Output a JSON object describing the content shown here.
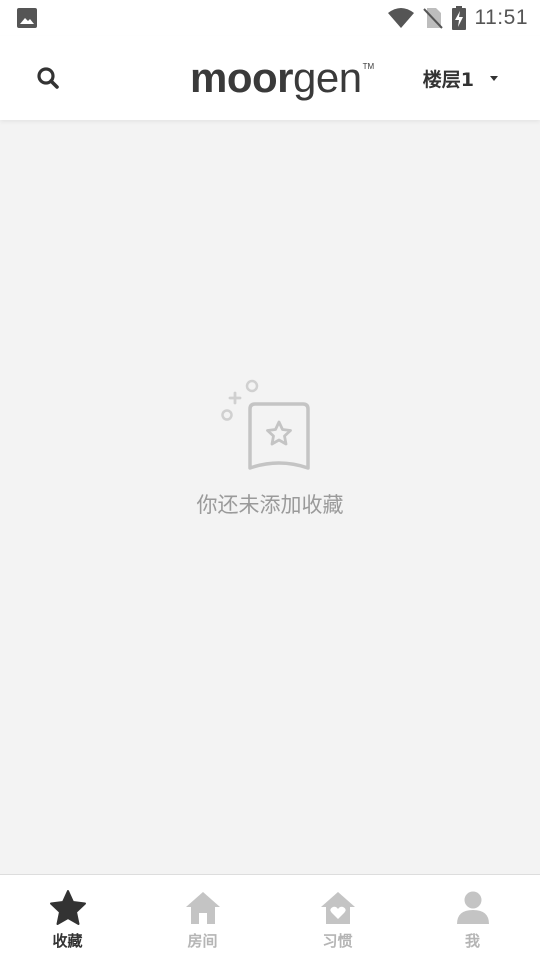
{
  "status_bar": {
    "time": "11:51",
    "icons": [
      "image-icon",
      "wifi-icon",
      "no-sim-icon",
      "battery-charging-icon"
    ]
  },
  "header": {
    "search_icon": "search-icon",
    "brand_bold": "moor",
    "brand_light": "gen",
    "brand_tm": "TM",
    "floor_label": "楼层1",
    "floor_caret_icon": "caret-down-icon"
  },
  "empty_state": {
    "icon": "favorite-empty-icon",
    "message": "你还未添加收藏"
  },
  "bottom_nav": {
    "items": [
      {
        "label": "收藏",
        "icon": "star-icon",
        "active": true
      },
      {
        "label": "房间",
        "icon": "home-icon",
        "active": false
      },
      {
        "label": "习惯",
        "icon": "home-heart-icon",
        "active": false
      },
      {
        "label": "我",
        "icon": "person-icon",
        "active": false
      }
    ]
  },
  "colors": {
    "background": "#f3f3f3",
    "header": "#ffffff",
    "active": "#333333",
    "inactive": "#b5b5b5",
    "empty_text": "#9a9a9a"
  }
}
